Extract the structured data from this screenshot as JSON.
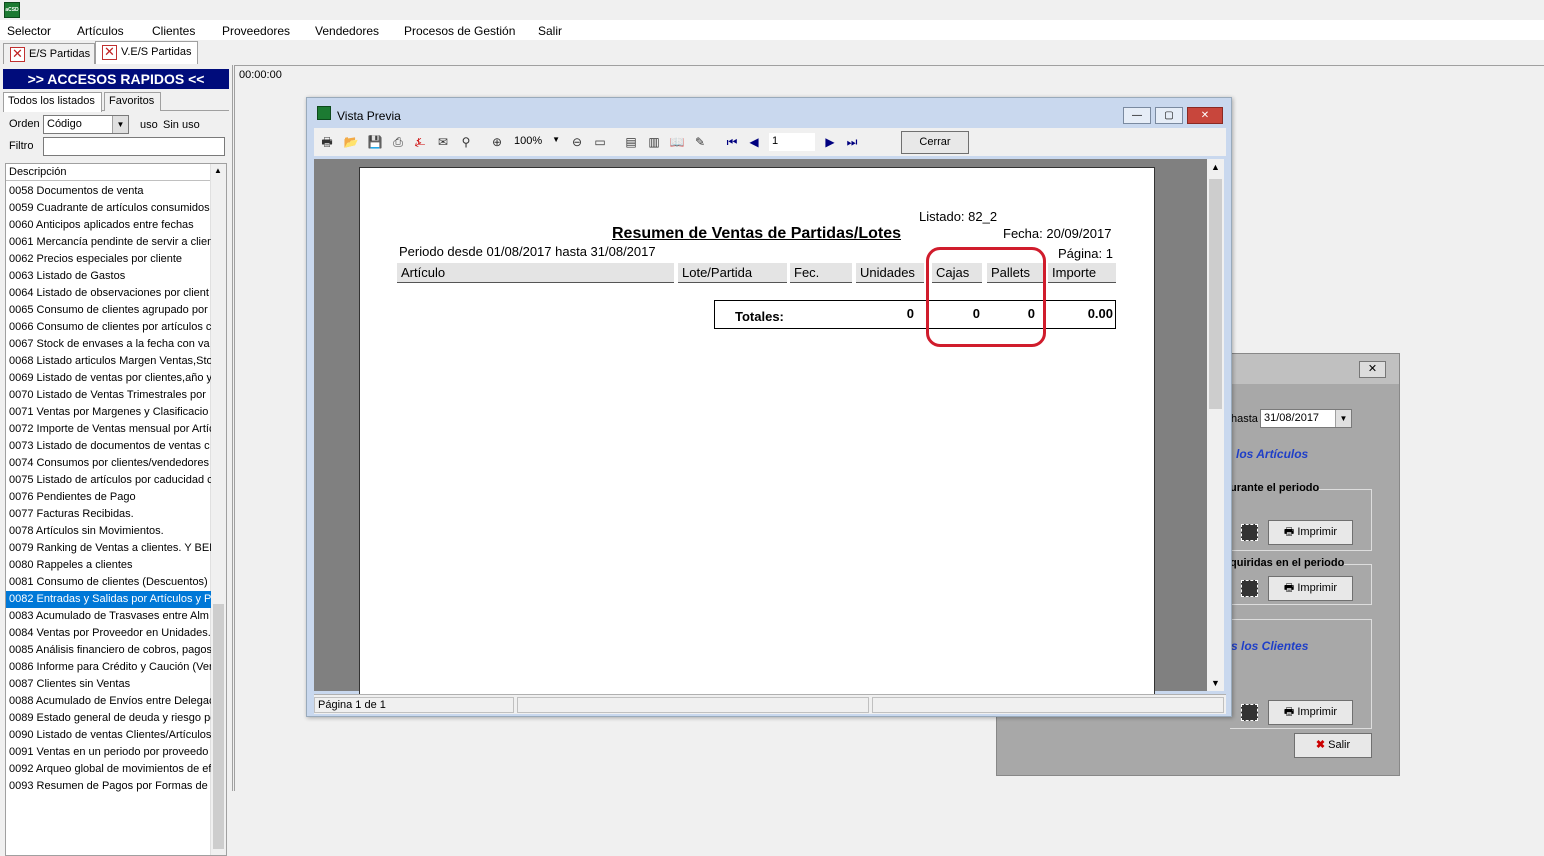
{
  "app": {
    "icon_label": "aCSD"
  },
  "menu": [
    "Selector",
    "Artículos",
    "Clientes",
    "Proveedores",
    "Vendedores",
    "Procesos de Gestión",
    "Salir"
  ],
  "doc_tabs": [
    {
      "label": "E/S Partidas",
      "active": false
    },
    {
      "label": "V.E/S Partidas",
      "active": true
    }
  ],
  "left_panel": {
    "header": ">>   ACCESOS RAPIDOS   <<",
    "tabs": [
      "Todos los listados",
      "Favoritos"
    ],
    "orden_label": "Orden",
    "orden_value": "Código",
    "uso_label": "uso",
    "uso_value": "Sin uso",
    "filtro_label": "Filtro",
    "filtro_value": "",
    "list_header": "Descripción",
    "items": [
      "0058 Documentos de venta",
      "0059 Cuadrante de artículos consumidos",
      "0060 Anticipos aplicados entre fechas",
      "0061 Mercancía pendinte de servir a clien",
      "0062 Precios especiales por cliente",
      "0063 Listado de Gastos",
      "0064 Listado de observaciones por client",
      "0065 Consumo de clientes agrupado por a",
      "0066 Consumo de clientes por artículos c",
      "0067 Stock de envases a la fecha con va",
      "0068 Listado articulos Margen Ventas,Sto",
      "0069 Listado de ventas por clientes,año y",
      "0070 Listado de Ventas Trimestrales por",
      "0071 Ventas por Margenes y Clasificacio",
      "0072 Importe de Ventas mensual por Artíc",
      "0073 Listado de documentos de ventas c",
      "0074 Consumos por clientes/vendedores",
      "0075 Listado de artículos por caducidad c",
      "0076 Pendientes de Pago",
      "0077 Facturas Recibidas.",
      "0078 Artículos sin Movimientos.",
      "0079 Ranking de Ventas a clientes. Y BEN",
      "0080 Rappeles a clientes",
      "0081 Consumo de clientes (Descuentos)",
      "0082 Entradas y Salidas por Artículos y P",
      "0083 Acumulado de Trasvases entre Alm",
      "0084 Ventas por Proveedor en Unidades.",
      "0085 Análisis financiero de cobros, pagos",
      "0086 Informe para Crédito y Caución (Ver",
      "0087 Clientes sin Ventas",
      "0088 Acumulado de Envíos entre Delegac",
      "0089 Estado general de deuda y riesgo pe",
      "0090 Listado de ventas Clientes/Artículos",
      "0091 Ventas en un periodo por proveedo",
      "0092 Arqueo global de movimientos de ef",
      "0093 Resumen de Pagos por Formas de F"
    ],
    "selected_index": 24
  },
  "timer": "00:00:00",
  "preview": {
    "title": "Vista Previa",
    "zoom": "100%",
    "page_input": "1",
    "close_button": "Cerrar",
    "status_page": "Página 1 de 1",
    "report": {
      "listado": "Listado:  82_2",
      "title": "Resumen de Ventas de Partidas/Lotes",
      "fecha": "Fecha: 20/09/2017",
      "periodo": "Periodo desde 01/08/2017 hasta 31/08/2017",
      "pagina": "Página: 1",
      "columns": [
        "Artículo",
        "Lote/Partida",
        "Fec.",
        "Unidades",
        "Cajas",
        "Pallets",
        "Importe"
      ],
      "totals_label": "Totales:",
      "totals": {
        "unidades": "0",
        "cajas": "0",
        "pallets": "0",
        "importe": "0.00"
      }
    }
  },
  "back_dialog": {
    "hasta_label": "hasta",
    "hasta_value": "31/08/2017",
    "link1": "los Artículos",
    "group1_title": "urante el periodo",
    "group2_title": "quiridas en el periodo",
    "link2": "s los Clientes",
    "print_label": "Imprimir",
    "exit_label": "Salir"
  },
  "colors": {
    "highlight_red": "#d01c2c",
    "selection_blue": "#0078d7",
    "header_navy": "#000c7b"
  }
}
